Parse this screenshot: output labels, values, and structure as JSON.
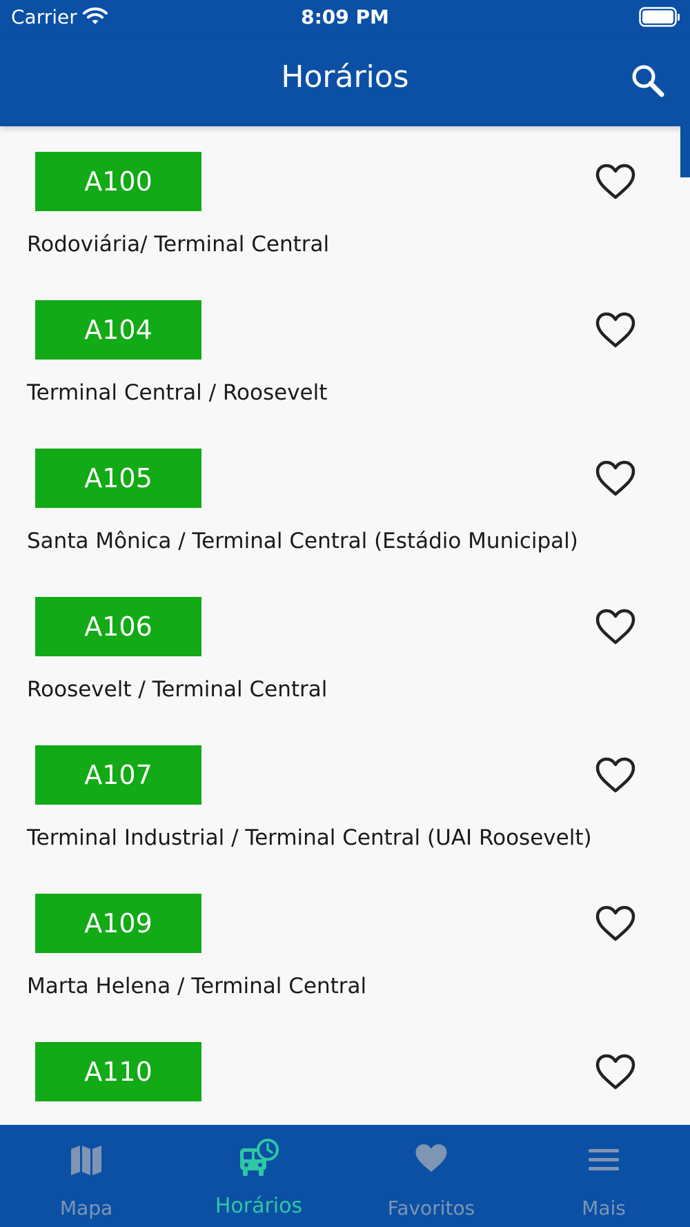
{
  "status_bar": {
    "carrier": "Carrier",
    "time": "8:09 PM",
    "wifi_icon": "wifi-icon",
    "battery_icon": "battery-icon"
  },
  "header": {
    "title": "Horários",
    "search_icon": "search-icon"
  },
  "routes": [
    {
      "code": "A100",
      "name": "Rodoviária/ Terminal Central"
    },
    {
      "code": "A104",
      "name": "Terminal Central / Roosevelt"
    },
    {
      "code": "A105",
      "name": "Santa Mônica / Terminal Central (Estádio Municipal)"
    },
    {
      "code": "A106",
      "name": "Roosevelt / Terminal Central"
    },
    {
      "code": "A107",
      "name": "Terminal Industrial / Terminal Central (UAI Roosevelt)"
    },
    {
      "code": "A109",
      "name": "Marta Helena / Terminal Central"
    },
    {
      "code": "A110",
      "name": ""
    }
  ],
  "tabs": [
    {
      "label": "Mapa",
      "icon": "map-icon"
    },
    {
      "label": "Horários",
      "icon": "bus-clock-icon",
      "active": true
    },
    {
      "label": "Favoritos",
      "icon": "heart-icon"
    },
    {
      "label": "Mais",
      "icon": "menu-icon"
    }
  ],
  "colors": {
    "primary": "#0b50a4",
    "route_badge": "#12aa16",
    "tab_active": "#2ec7a2",
    "tab_inactive": "#7f95b4",
    "background": "#f8f8f8"
  }
}
